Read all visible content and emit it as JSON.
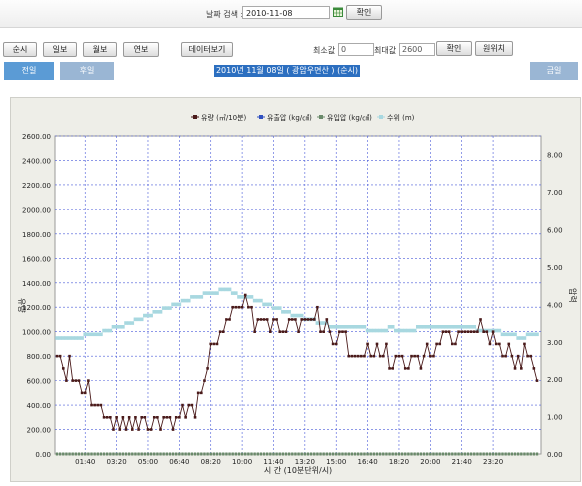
{
  "search": {
    "date_label": "날짜 검색 :",
    "date_value": "2010-11-08",
    "confirm_label": "확인"
  },
  "toolbar": {
    "period_buttons": [
      "순시",
      "일보",
      "월보",
      "연보"
    ],
    "data_view_label": "데이터보기",
    "min_label": "최소값",
    "min_value": "0",
    "max_label": "최대값",
    "max_value": "2600",
    "apply_label": "확인",
    "reset_label": "원위치"
  },
  "tabs": {
    "prev": "전일",
    "next": "후일",
    "title": "2010년 11월 08일 ( 광암우면산 ) (순시)",
    "right": "금일"
  },
  "colors": {
    "tab_active": "#5b9bd5",
    "tab_inactive": "#9ab6d4",
    "flow": "#4a1a1a",
    "level": "#a8d8e0",
    "inlet": "#6a8a6a",
    "grid": "#4a5bd9"
  },
  "chart_data": {
    "type": "line",
    "legend": [
      "유량 (㎥/10분)",
      "유출압 (kg/㎠)",
      "유입압 (kg/㎠)",
      "수위 (m)"
    ],
    "xlabel": "시 간 (10분단위/시)",
    "ylabel_left": "유량",
    "ylabel_right": "압력",
    "x_ticks": [
      "01:40",
      "03:20",
      "05:00",
      "06:40",
      "08:20",
      "10:00",
      "11:40",
      "13:20",
      "15:00",
      "16:40",
      "18:20",
      "20:00",
      "21:40",
      "23:20"
    ],
    "y_left_ticks": [
      "0.00",
      "200.00",
      "400.00",
      "600.00",
      "800.00",
      "1000.00",
      "1200.00",
      "1400.00",
      "1600.00",
      "1800.00",
      "2000.00",
      "2200.00",
      "2400.00",
      "2600.00"
    ],
    "y_right_ticks": [
      "0.00",
      "1.00",
      "2.00",
      "3.00",
      "4.00",
      "5.00",
      "6.00",
      "7.00",
      "8.00"
    ],
    "ylim_left": [
      0,
      2600
    ],
    "ylim_right": [
      0,
      8.5
    ],
    "x_interval_minutes": 10,
    "flow": [
      800,
      800,
      700,
      600,
      800,
      600,
      600,
      600,
      500,
      500,
      600,
      400,
      400,
      400,
      400,
      300,
      300,
      300,
      200,
      300,
      200,
      300,
      200,
      300,
      200,
      300,
      200,
      300,
      300,
      200,
      200,
      300,
      300,
      200,
      300,
      300,
      300,
      200,
      300,
      300,
      400,
      300,
      400,
      400,
      300,
      500,
      500,
      600,
      700,
      900,
      900,
      900,
      1000,
      1000,
      1100,
      1100,
      1200,
      1200,
      1200,
      1200,
      1300,
      1200,
      1200,
      1000,
      1100,
      1100,
      1100,
      1100,
      1000,
      1100,
      1100,
      1000,
      1000,
      1000,
      1100,
      1100,
      1100,
      1000,
      1100,
      1100,
      1100,
      1100,
      1100,
      1200,
      1000,
      1000,
      1100,
      1000,
      900,
      900,
      1000,
      1000,
      1000,
      800,
      800,
      800,
      800,
      800,
      800,
      900,
      800,
      800,
      900,
      800,
      800,
      900,
      700,
      700,
      800,
      800,
      800,
      700,
      700,
      800,
      800,
      800,
      700,
      800,
      900,
      800,
      800,
      900,
      900,
      1000,
      1000,
      1000,
      900,
      900,
      1000,
      1000,
      1000,
      1000,
      1000,
      1000,
      1000,
      1100,
      1000,
      1000,
      900,
      1000,
      900,
      900,
      800,
      800,
      900,
      800,
      700,
      800,
      700,
      900,
      800,
      800,
      700,
      600
    ],
    "level": [
      3.1,
      3.1,
      3.1,
      3.1,
      3.1,
      3.1,
      3.1,
      3.1,
      3.1,
      3.2,
      3.2,
      3.2,
      3.2,
      3.2,
      3.2,
      3.3,
      3.3,
      3.3,
      3.4,
      3.4,
      3.4,
      3.4,
      3.5,
      3.5,
      3.5,
      3.6,
      3.6,
      3.6,
      3.7,
      3.7,
      3.7,
      3.8,
      3.8,
      3.8,
      3.9,
      3.9,
      3.9,
      4.0,
      4.0,
      4.0,
      4.1,
      4.1,
      4.1,
      4.2,
      4.2,
      4.2,
      4.2,
      4.3,
      4.3,
      4.3,
      4.3,
      4.3,
      4.4,
      4.4,
      4.4,
      4.4,
      4.3,
      4.3,
      4.2,
      4.2,
      4.2,
      4.2,
      4.2,
      4.1,
      4.1,
      4.1,
      4.0,
      4.0,
      4.0,
      3.9,
      3.9,
      3.9,
      3.8,
      3.8,
      3.8,
      3.7,
      3.7,
      3.7,
      3.7,
      3.6,
      3.6,
      3.6,
      3.6,
      3.5,
      3.5,
      3.5,
      3.5,
      3.4,
      3.4,
      3.4,
      3.4,
      3.4,
      3.4,
      3.4,
      3.4,
      3.4,
      3.4,
      3.4,
      3.4,
      3.3,
      3.3,
      3.3,
      3.3,
      3.3,
      3.3,
      3.3,
      3.4,
      3.4,
      3.3,
      3.3,
      3.3,
      3.3,
      3.3,
      3.3,
      3.3,
      3.4,
      3.4,
      3.4,
      3.4,
      3.4,
      3.4,
      3.4,
      3.4,
      3.4,
      3.4,
      3.4,
      3.4,
      3.4,
      3.4,
      3.4,
      3.4,
      3.4,
      3.4,
      3.4,
      3.3,
      3.3,
      3.3,
      3.3,
      3.3,
      3.3,
      3.3,
      3.3,
      3.2,
      3.2,
      3.2,
      3.2,
      3.2,
      3.1,
      3.1,
      3.1,
      3.2,
      3.2
    ],
    "outlet_pressure": 0,
    "inlet_pressure": 0
  }
}
